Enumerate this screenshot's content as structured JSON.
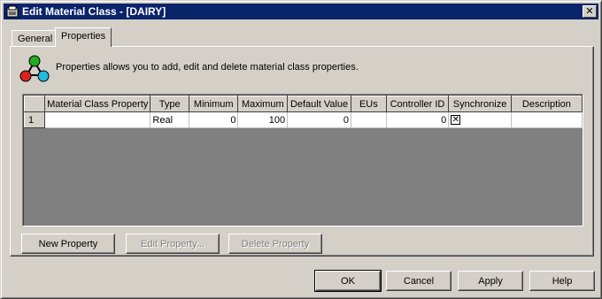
{
  "window": {
    "title": "Edit Material Class - [DAIRY]",
    "close_glyph": "✕"
  },
  "tabs": [
    {
      "label": "General",
      "active": false
    },
    {
      "label": "Properties",
      "active": true
    }
  ],
  "info": {
    "text": "Properties allows you to add, edit and delete material class properties.",
    "icon": "molecule-icon"
  },
  "grid": {
    "columns": [
      "",
      "Material Class Property",
      "Type",
      "Minimum",
      "Maximum",
      "Default Value",
      "EUs",
      "Controller ID",
      "Synchronize",
      "Description"
    ],
    "rows": [
      {
        "row_number": "1",
        "material_class_property": "",
        "type": "Real",
        "minimum": "0",
        "maximum": "100",
        "default_value": "0",
        "eus": "",
        "controller_id": "0",
        "synchronize_glyph": "✕",
        "description": ""
      }
    ]
  },
  "buttons": {
    "new_property": "New Property",
    "edit_property": "Edit Property...",
    "delete_property": "Delete Property",
    "ok": "OK",
    "cancel": "Cancel",
    "apply": "Apply",
    "help": "Help"
  },
  "colors": {
    "titlebar": "#0a246a",
    "face": "#d4d0c8"
  }
}
